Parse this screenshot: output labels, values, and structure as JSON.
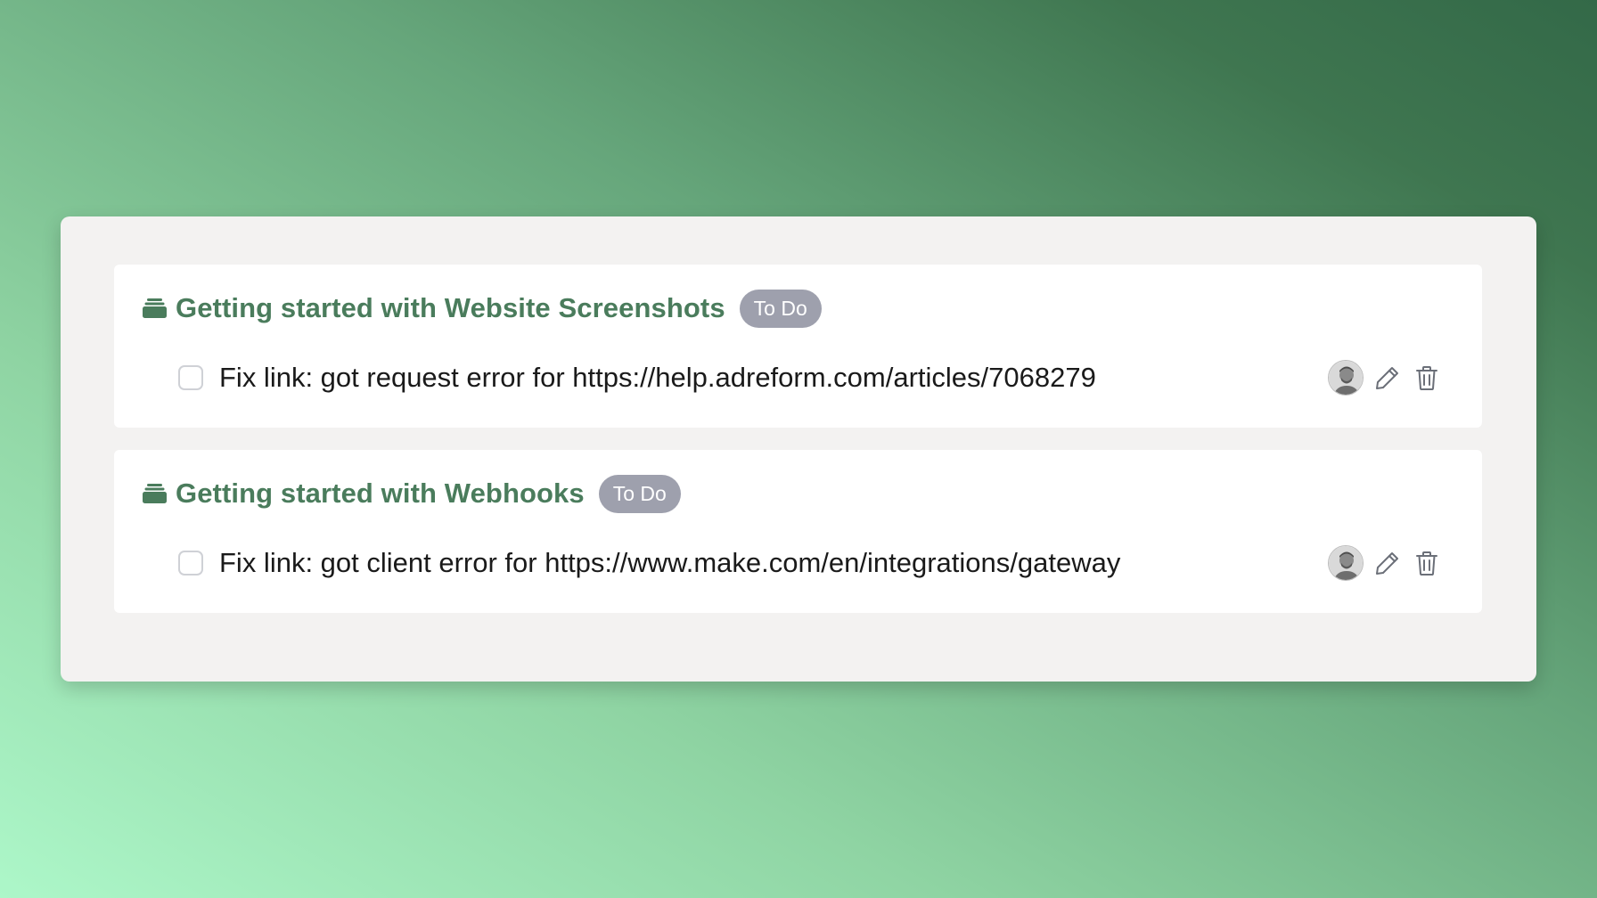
{
  "projects": [
    {
      "icon": "folder-stack-icon",
      "title": "Getting started with Website Screenshots",
      "status": "To Do",
      "task": {
        "text": "Fix link: got request error for https://help.adreform.com/articles/7068279",
        "checked": false,
        "assignee_avatar": "avatar",
        "actions": [
          "pencil-icon",
          "trash-icon"
        ]
      }
    },
    {
      "icon": "folder-stack-icon",
      "title": "Getting started with Webhooks",
      "status": "To Do",
      "task": {
        "text": "Fix link: got client error for https://www.make.com/en/integrations/gateway",
        "checked": false,
        "assignee_avatar": "avatar",
        "actions": [
          "pencil-icon",
          "trash-icon"
        ]
      }
    }
  ],
  "colors": {
    "title": "#4a7c5c",
    "badge": "#9ea0ad",
    "panel": "#f3f2f1"
  }
}
